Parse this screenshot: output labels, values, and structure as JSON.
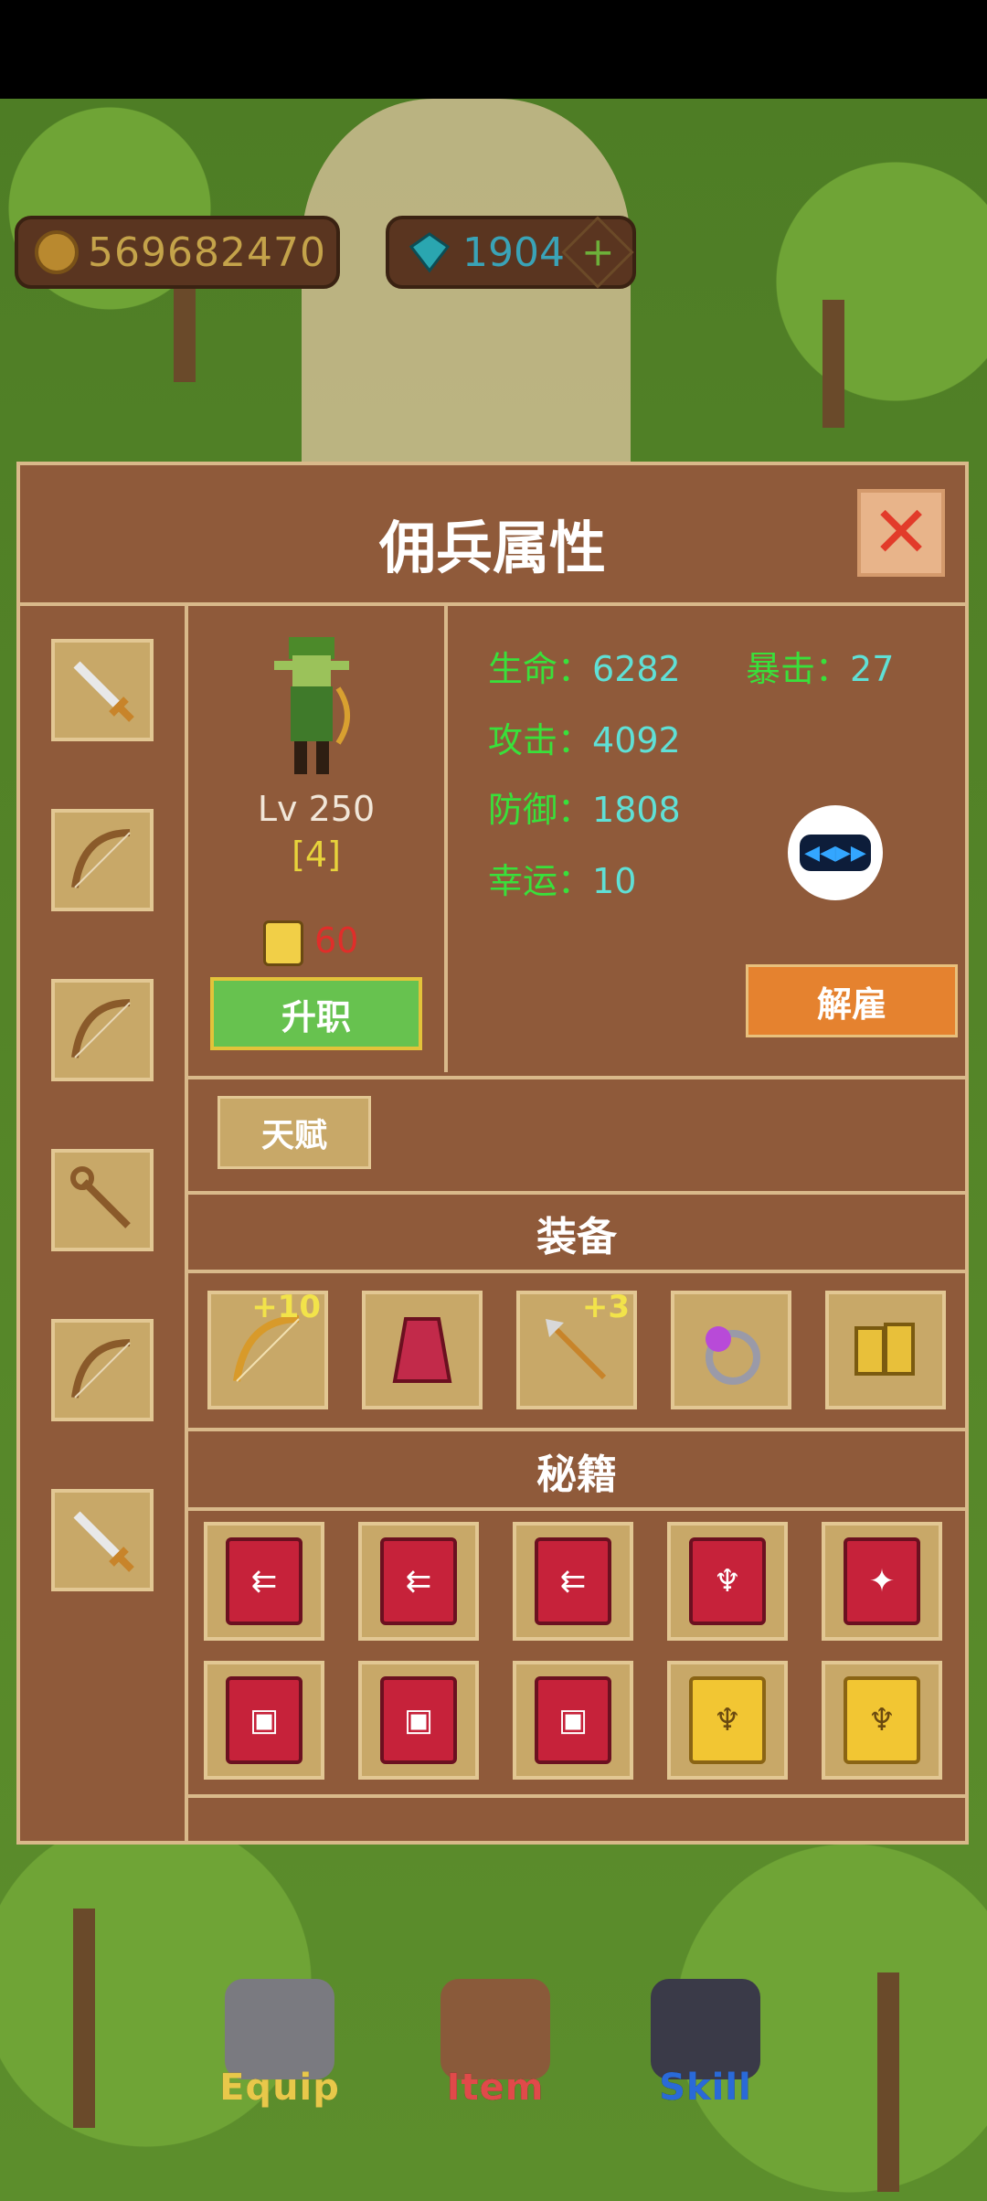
{
  "resources": {
    "gold": "569682470",
    "gems": "1904",
    "plus": "+"
  },
  "panel": {
    "title": "佣兵属性",
    "close_symbol": "✕",
    "level": "Lv 250",
    "rank": "[4]",
    "ticket_cost": "60",
    "promote_label": "升职",
    "fire_label": "解雇",
    "talent_label": "天赋",
    "stats": {
      "hp_label": "生命：",
      "hp": "6282",
      "crit_label": "暴击：",
      "crit": "27",
      "atk_label": "攻击：",
      "atk": "4092",
      "def_label": "防御：",
      "def": "1808",
      "luck_label": "幸运：",
      "luck": "10"
    },
    "equipment_title": "装备",
    "equipment": [
      {
        "icon": "bow-icon",
        "plus": "+10"
      },
      {
        "icon": "cloak-icon",
        "plus": ""
      },
      {
        "icon": "arrow-icon",
        "plus": "+3"
      },
      {
        "icon": "ring-icon",
        "plus": ""
      },
      {
        "icon": "boots-icon",
        "plus": ""
      }
    ],
    "secrets_title": "秘籍",
    "sidebar_slots": [
      "sword-icon",
      "bow-icon",
      "bow-icon",
      "staff-icon",
      "bow-icon",
      "sword-icon"
    ]
  },
  "bottom_nav": {
    "equip": "Equip",
    "item": "Item",
    "skill": "Skill"
  },
  "colors": {
    "panel_bg": "#8f5a3a",
    "border": "#d9b98a",
    "promote": "#67c24f",
    "fire": "#e5822f"
  }
}
